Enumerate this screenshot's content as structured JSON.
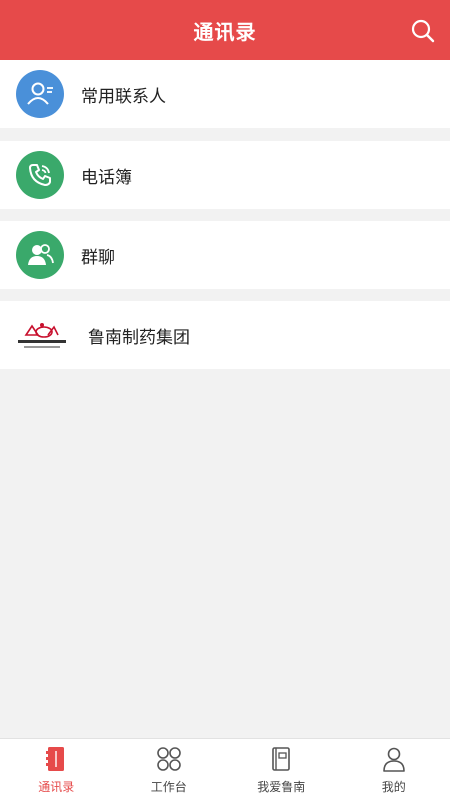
{
  "header": {
    "title": "通讯录",
    "search_icon": "search-icon"
  },
  "contacts": {
    "items": [
      {
        "label": "常用联系人",
        "icon": "user-card-icon",
        "color": "#4a90d9"
      },
      {
        "label": "电话簿",
        "icon": "phone-icon",
        "color": "#3aa96b"
      },
      {
        "label": "群聊",
        "icon": "group-icon",
        "color": "#3aa96b"
      },
      {
        "label": "鲁南制药集团",
        "icon": "company-logo"
      }
    ]
  },
  "bottom_nav": {
    "active_color": "#e64a4a",
    "items": [
      {
        "label": "通讯录",
        "icon": "address-book-icon",
        "active": true
      },
      {
        "label": "工作台",
        "icon": "workbench-icon",
        "active": false
      },
      {
        "label": "我爱鲁南",
        "icon": "book-icon",
        "active": false
      },
      {
        "label": "我的",
        "icon": "person-icon",
        "active": false
      }
    ]
  }
}
